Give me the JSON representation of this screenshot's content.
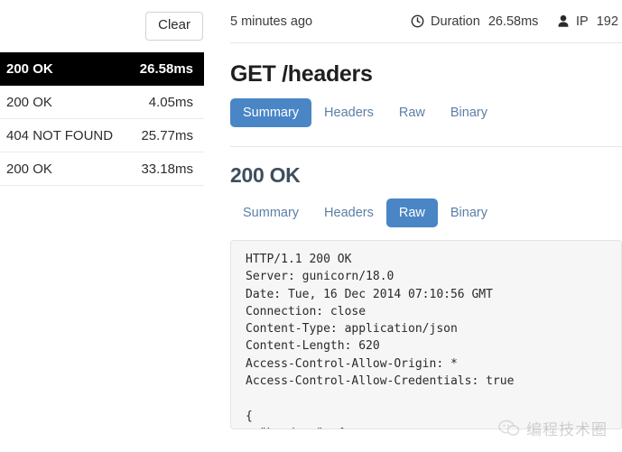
{
  "sidebar": {
    "clear_label": "Clear",
    "requests": [
      {
        "status": "200 OK",
        "time": "26.58ms",
        "selected": true
      },
      {
        "status": "200 OK",
        "time": "4.05ms",
        "selected": false
      },
      {
        "status": "404 NOT FOUND",
        "time": "25.77ms",
        "selected": false
      },
      {
        "status": "200 OK",
        "time": "33.18ms",
        "selected": false
      }
    ]
  },
  "meta": {
    "timestamp": "5 minutes ago",
    "duration_icon": "clock-icon",
    "duration_label": "Duration",
    "duration_value": "26.58ms",
    "ip_icon": "person-icon",
    "ip_label": "IP",
    "ip_value": "192"
  },
  "request": {
    "title": "GET /headers",
    "tabs": [
      {
        "label": "Summary",
        "active": true
      },
      {
        "label": "Headers",
        "active": false
      },
      {
        "label": "Raw",
        "active": false
      },
      {
        "label": "Binary",
        "active": false
      }
    ]
  },
  "response": {
    "title": "200 OK",
    "tabs": [
      {
        "label": "Summary",
        "active": false
      },
      {
        "label": "Headers",
        "active": false
      },
      {
        "label": "Raw",
        "active": true
      },
      {
        "label": "Binary",
        "active": false
      }
    ],
    "raw": "HTTP/1.1 200 OK\nServer: gunicorn/18.0\nDate: Tue, 16 Dec 2014 07:10:56 GMT\nConnection: close\nContent-Type: application/json\nContent-Length: 620\nAccess-Control-Allow-Origin: *\nAccess-Control-Allow-Credentials: true\n\n{\n  \"headers\": {"
  },
  "watermark": {
    "icon": "wechat-bubble-icon",
    "text": "编程技术圈"
  },
  "colors": {
    "accent": "#4a86c5",
    "link": "#5b7fa6",
    "selected_row_bg": "#000000",
    "response_title": "#3e4e5e",
    "code_bg": "#f6f6f6"
  }
}
